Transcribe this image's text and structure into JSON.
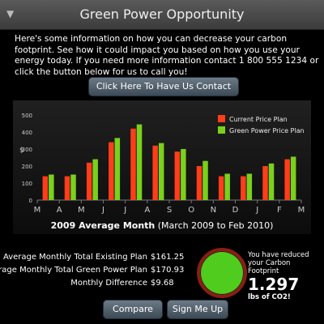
{
  "header": {
    "title": "Green Power Opportunity",
    "toggle_icon": "chevron-down-icon"
  },
  "intro": {
    "text": "Here's some information on how you can decrease your carbon footprint.  See how it could impact you based on how you use your energy today.  If you need more information contact 1 800 555 1234 or click the button below for us to call you!"
  },
  "cta": {
    "label": "Click Here To Have Us Contact You"
  },
  "chart_caption": {
    "bold": "2009 Average Month",
    "rest": " (March 2009 to Feb 2010)"
  },
  "chart_data": {
    "type": "bar",
    "categories": [
      "M",
      "A",
      "M",
      "J",
      "J",
      "A",
      "S",
      "O",
      "N",
      "D",
      "J",
      "F",
      "M"
    ],
    "series": [
      {
        "name": "Current Price Plan",
        "color": "#ff3d1a",
        "values": [
          140,
          140,
          220,
          340,
          420,
          320,
          285,
          200,
          140,
          140,
          200,
          240
        ]
      },
      {
        "name": "Green Power Price Plan",
        "color": "#7ad11a",
        "values": [
          150,
          150,
          240,
          365,
          445,
          335,
          300,
          230,
          155,
          155,
          215,
          255
        ]
      }
    ],
    "ylabel": "$",
    "ylim": [
      0,
      500
    ],
    "yticks": [
      0,
      100,
      200,
      300,
      400,
      500
    ],
    "legend": "top-right"
  },
  "stats": [
    {
      "label": "Average Monthly Total Existing Plan",
      "value": "$161.25"
    },
    {
      "label": "Average Monthly Total Green Power Plan",
      "value": "$170.93"
    },
    {
      "label": "Monthly Difference",
      "value": "$9.68"
    }
  ],
  "savings": {
    "line1": "You have reduced your Carbon Footprint",
    "amount": "1.297",
    "line2": "lbs of CO2!"
  },
  "buttons": {
    "compare": "Compare",
    "signup": "Sign Me Up"
  }
}
